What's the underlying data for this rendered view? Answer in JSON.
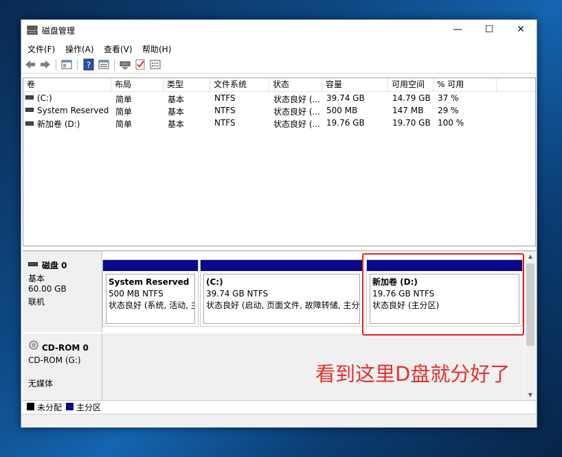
{
  "window": {
    "title": "磁盘管理"
  },
  "menu": [
    "文件(F)",
    "操作(A)",
    "查看(V)",
    "帮助(H)"
  ],
  "icons": {
    "app": "disk-management-icon",
    "minimize": "—",
    "maximize": "☐",
    "close": "✕"
  },
  "columns": [
    "卷",
    "布局",
    "类型",
    "文件系统",
    "状态",
    "容量",
    "可用空间",
    "% 可用"
  ],
  "volumes": [
    [
      "(C:)",
      "简单",
      "基本",
      "NTFS",
      "状态良好 (...",
      "39.74 GB",
      "14.79 GB",
      "37 %"
    ],
    [
      "System Reserved",
      "简单",
      "基本",
      "NTFS",
      "状态良好 (...",
      "500 MB",
      "147 MB",
      "29 %"
    ],
    [
      "新加卷 (D:)",
      "简单",
      "基本",
      "NTFS",
      "状态良好 (...",
      "19.76 GB",
      "19.70 GB",
      "100 %"
    ]
  ],
  "disk0": {
    "name": "磁盘 0",
    "type": "基本",
    "size": "60.00 GB",
    "status": "联机",
    "partitions": [
      {
        "name": "System Reserved",
        "size": "500 MB NTFS",
        "status": "状态良好 (系统, 活动, 主"
      },
      {
        "name": "(C:)",
        "size": "39.74 GB NTFS",
        "status": "状态良好 (启动, 页面文件, 故障转储, 主分区"
      },
      {
        "name": "新加卷  (D:)",
        "size": "19.76 GB NTFS",
        "status": "状态良好 (主分区)"
      }
    ]
  },
  "cdrom": {
    "name": "CD-ROM 0",
    "drive": "CD-ROM (G:)",
    "media": "无媒体"
  },
  "legend": [
    {
      "label": "未分配",
      "color": "#000000"
    },
    {
      "label": "主分区",
      "color": "#0a0a8a"
    }
  ],
  "annotation": "看到这里D盘就分好了",
  "colors": {
    "partition_bar": "#0a0a8a",
    "highlight": "#e62020"
  }
}
